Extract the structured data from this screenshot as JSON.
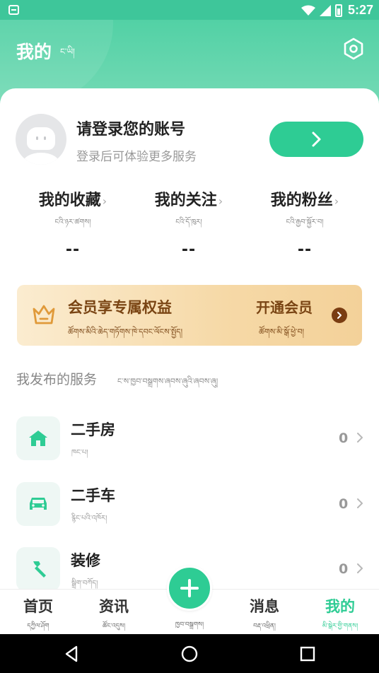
{
  "status_bar": {
    "time": "5:27"
  },
  "header": {
    "title": "我的",
    "subtitle": "ང་ཡི།"
  },
  "profile": {
    "title": "请登录您的账号",
    "subtitle": "登录后可体验更多服务"
  },
  "stats": [
    {
      "label": "我的收藏",
      "sub": "ངའི་ཉར་ཚགས།",
      "value": "--"
    },
    {
      "label": "我的关注",
      "sub": "ངའི་དོ་ཁུར།",
      "value": "--"
    },
    {
      "label": "我的粉丝",
      "sub": "ངའི་རྒྱབ་སྐྱོར་བ།",
      "value": "--"
    }
  ],
  "vip": {
    "title": "会员享专属权益",
    "subtitle": "ཚོགས་མིའི་ཆེད་གཏོགས་ཁེ་དབང་ལོངས་སྤྱོད།",
    "action": "开通会员",
    "action_sub": "ཚོགས་མི་སྒོ་ཕྱེ་བ།"
  },
  "section": {
    "title": "我发布的服务",
    "subtitle": "ང་ས་ཁྱབ་བསྒྲགས་ཞབས་ཞུའི་ཞབས་ཞུ།"
  },
  "services": [
    {
      "title": "二手房",
      "sub": "ཁང་པ།",
      "count": "0",
      "icon": "house-icon"
    },
    {
      "title": "二手车",
      "sub": "རྙིང་པའི་འཁོར།",
      "count": "0",
      "icon": "car-icon"
    },
    {
      "title": "装修",
      "sub": "སྒྲིག་བཀོད།",
      "count": "0",
      "icon": "hammer-icon"
    }
  ],
  "tabbar": {
    "items": [
      {
        "label": "首页",
        "sub": "དཀྱིལ་ཤོག"
      },
      {
        "label": "资讯",
        "sub": "ཚོང་འདུས།"
      },
      {
        "label": "消息",
        "sub": "བརྡ་འཕྲིན།"
      },
      {
        "label": "我的",
        "sub": "མི་སྒེར་གྱི་གནས།"
      }
    ],
    "publish_sub": "ཁྱབ་བསྒྲགས།"
  },
  "colors": {
    "accent": "#2ecc94",
    "header": "#52d1a5",
    "vip_text": "#7a4514"
  }
}
